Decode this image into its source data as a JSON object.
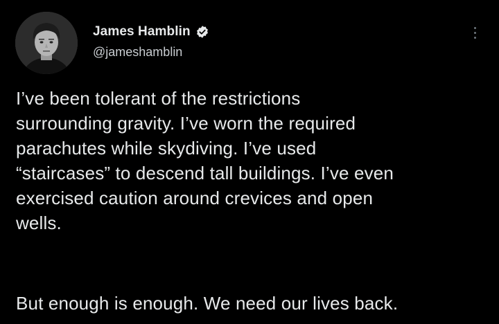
{
  "author": {
    "display_name": "James Hamblin",
    "handle": "@jameshamblin",
    "verified_icon": "verified-badge-icon",
    "avatar": "avatar-photo"
  },
  "actions": {
    "more_icon": "more-options-icon"
  },
  "tweet": {
    "lines": [
      "I’ve been tolerant of the restrictions",
      "surrounding gravity. I’ve worn the required",
      "parachutes while skydiving. I’ve used",
      "“staircases” to descend tall buildings. I’ve even",
      "exercised caution around crevices and open",
      "wells."
    ],
    "closing": "But enough is enough. We need our lives back."
  },
  "colors": {
    "background": "#000000",
    "text": "#e7e9ea",
    "secondary_text": "#c9cdd1",
    "verified": "#e7e9ea"
  }
}
